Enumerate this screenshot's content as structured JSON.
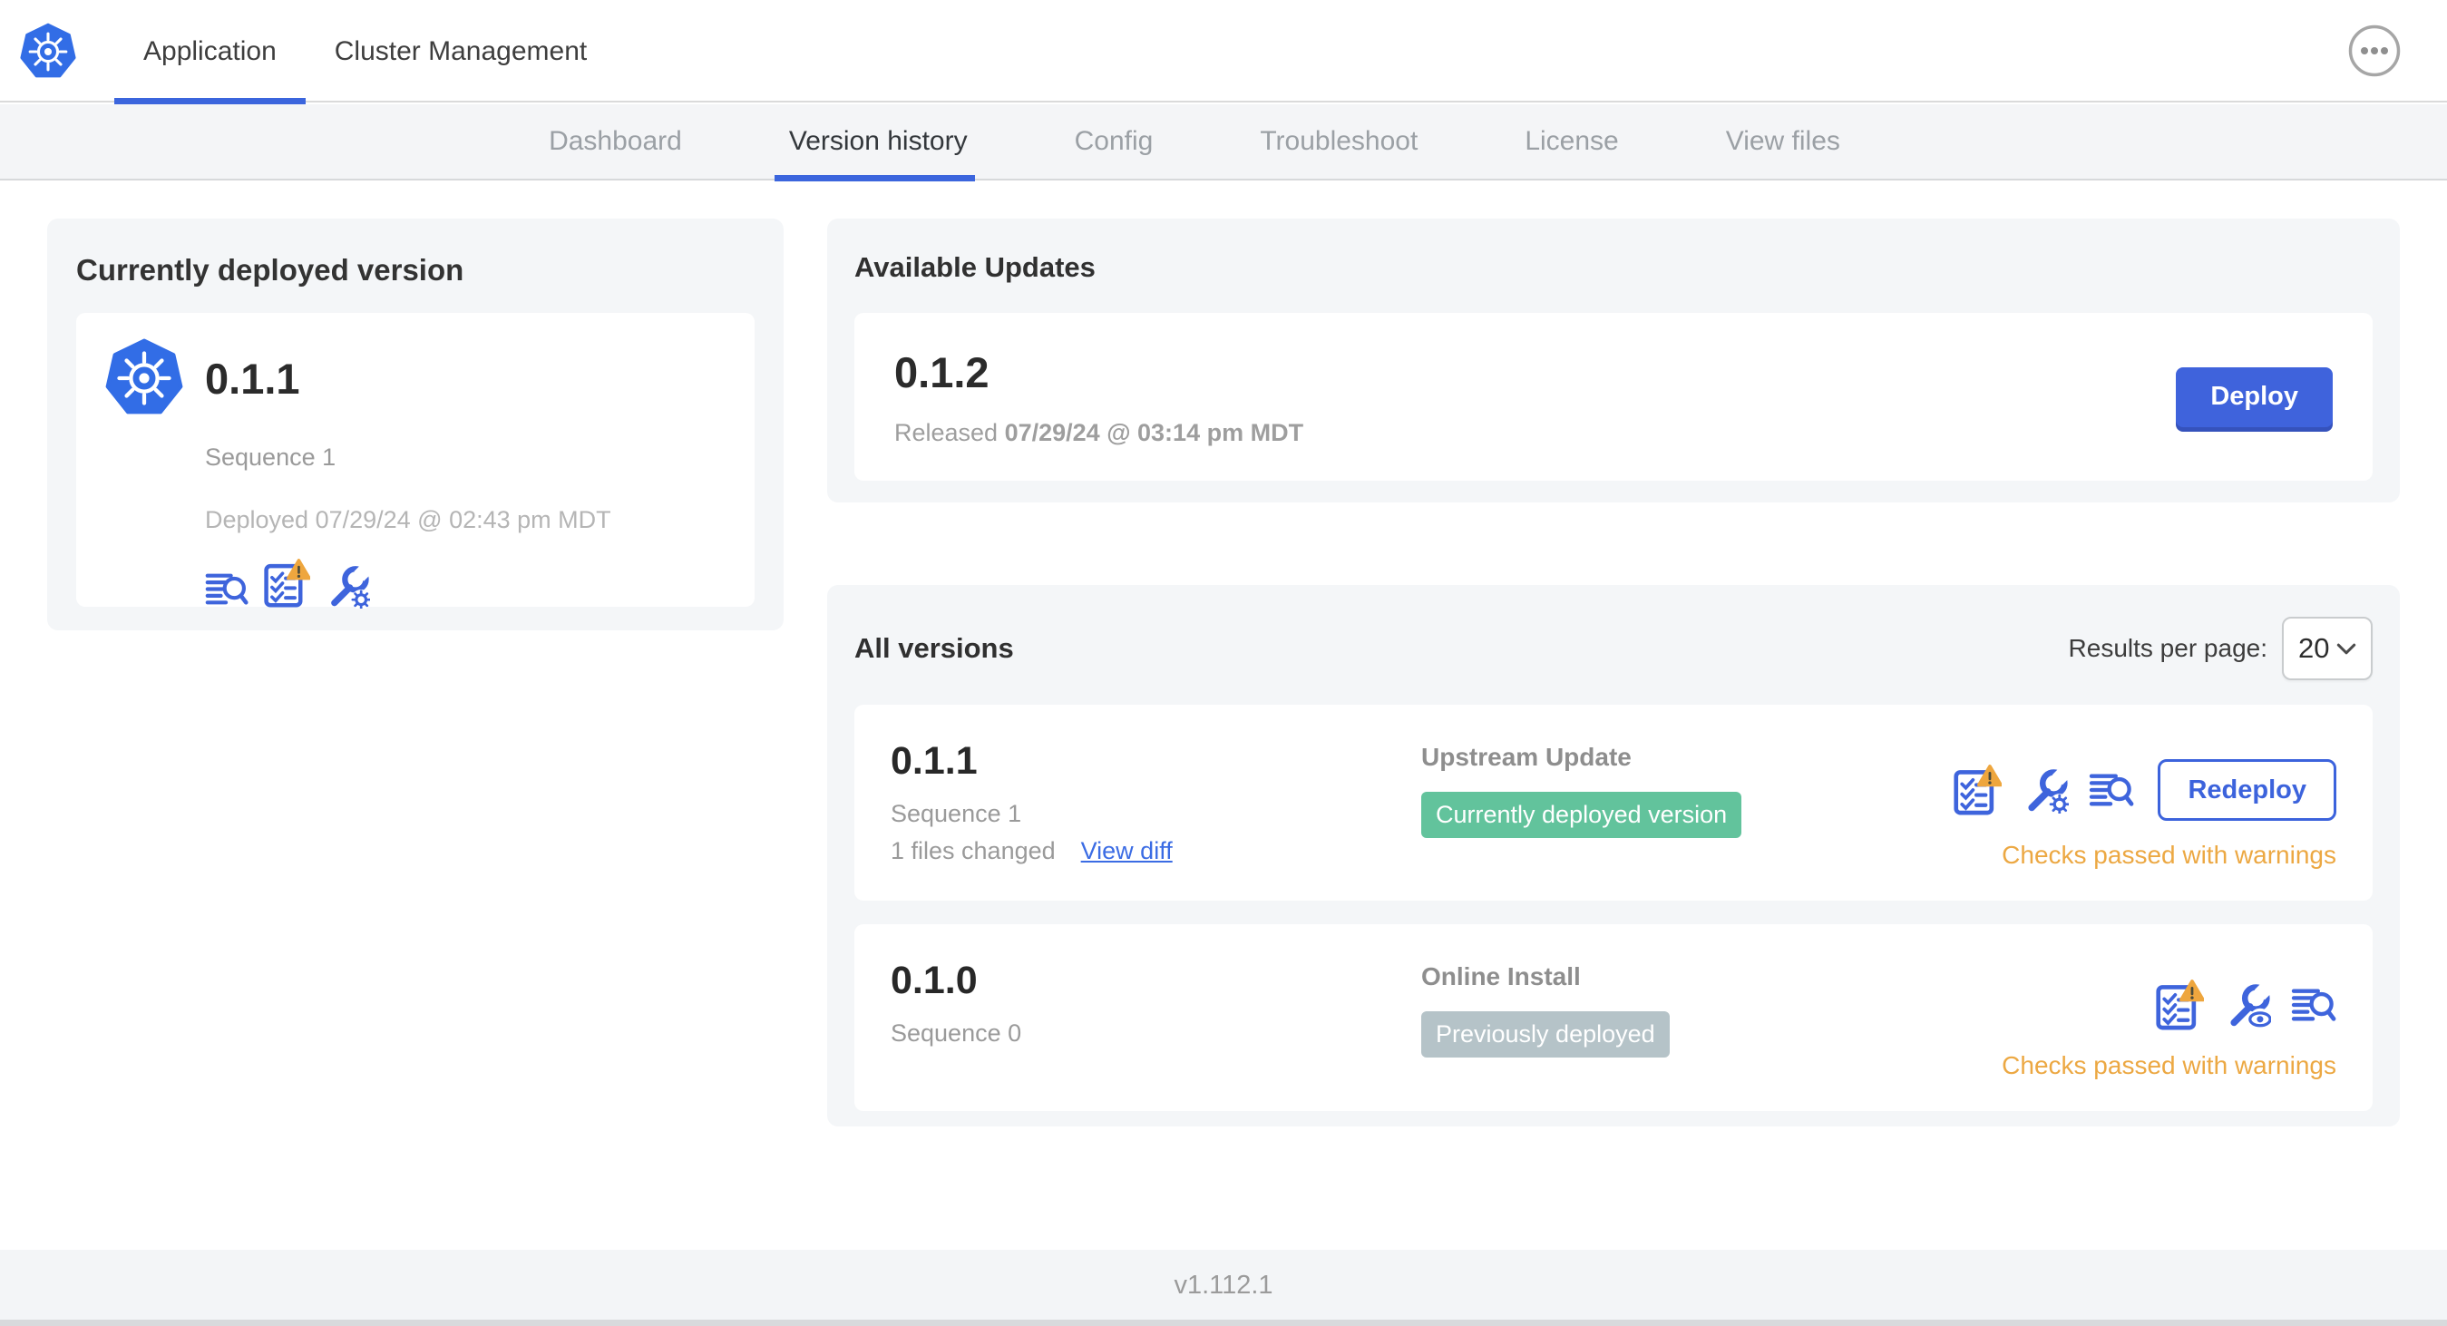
{
  "topbar": {
    "tabs": [
      {
        "label": "Application",
        "active": true
      },
      {
        "label": "Cluster Management",
        "active": false
      }
    ],
    "menu_icon": "ellipsis-icon"
  },
  "subnav": {
    "items": [
      {
        "label": "Dashboard",
        "active": false
      },
      {
        "label": "Version history",
        "active": true
      },
      {
        "label": "Config",
        "active": false
      },
      {
        "label": "Troubleshoot",
        "active": false
      },
      {
        "label": "License",
        "active": false
      },
      {
        "label": "View files",
        "active": false
      }
    ]
  },
  "current_version": {
    "title": "Currently deployed version",
    "version": "0.1.1",
    "sequence": "Sequence 1",
    "deployed": "Deployed 07/29/24 @ 02:43 pm MDT",
    "icons": [
      "diff-icon",
      "preflight-checks-warning-icon",
      "config-edit-icon"
    ]
  },
  "available_updates": {
    "title": "Available Updates",
    "version": "0.1.2",
    "released_label": "Released",
    "released_date": "07/29/24 @ 03:14 pm MDT",
    "deploy_button": "Deploy"
  },
  "all_versions": {
    "title": "All versions",
    "results_per_page_label": "Results per page:",
    "results_per_page": "20",
    "rows": [
      {
        "version": "0.1.1",
        "sequence": "Sequence 1",
        "files_changed": "1 files changed",
        "view_diff_link": "View diff",
        "source": "Upstream Update",
        "badge": "Currently deployed version",
        "badge_style": "green",
        "action_button": "Redeploy",
        "status": "Checks passed with warnings",
        "icons": [
          "preflight-checks-warning-icon",
          "config-edit-icon",
          "diff-icon"
        ]
      },
      {
        "version": "0.1.0",
        "sequence": "Sequence 0",
        "source": "Online Install",
        "badge": "Previously deployed",
        "badge_style": "gray",
        "status": "Checks passed with warnings",
        "icons": [
          "preflight-checks-warning-icon",
          "config-view-icon",
          "diff-icon"
        ]
      }
    ]
  },
  "footer": {
    "version": "v1.112.1"
  },
  "colors": {
    "accent_blue": "#3b63dc",
    "k8s_blue": "#326de6",
    "badge_green": "#62c39c",
    "badge_gray": "#b5c3c8",
    "warning_orange": "#eca843",
    "card_bg": "#f4f6f8"
  }
}
